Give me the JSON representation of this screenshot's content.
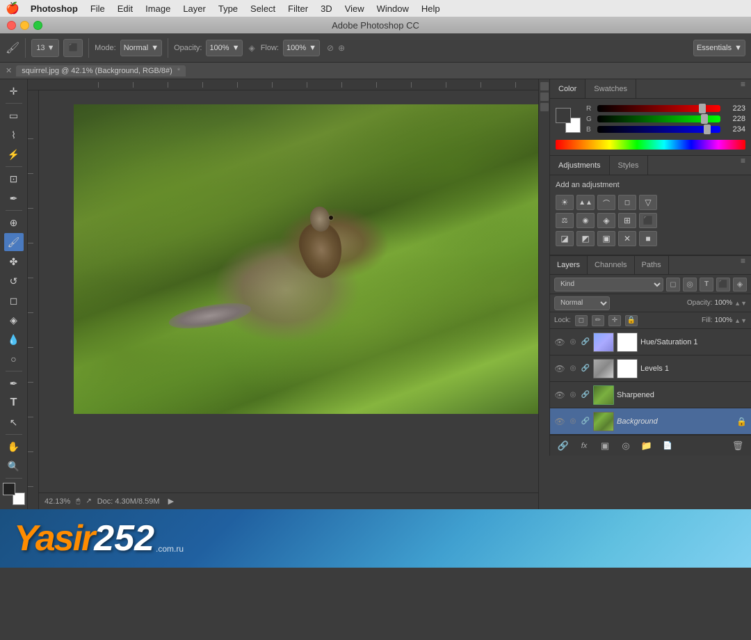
{
  "app": {
    "name": "Photoshop",
    "title": "Adobe Photoshop CC",
    "workspace": "Essentials"
  },
  "menubar": {
    "apple": "🍎",
    "items": [
      "Photoshop",
      "File",
      "Edit",
      "Image",
      "Layer",
      "Type",
      "Select",
      "Filter",
      "3D",
      "View",
      "Window",
      "Help"
    ]
  },
  "toolbar": {
    "brush_size": "13",
    "mode_label": "Mode:",
    "mode_value": "Normal",
    "opacity_label": "Opacity:",
    "opacity_value": "100%",
    "flow_label": "Flow:",
    "flow_value": "100%",
    "workspace": "Essentials"
  },
  "document": {
    "tab_title": "squirrel.jpg @ 42.1% (Background, RGB/8#)",
    "zoom": "42.13%",
    "doc_size": "Doc: 4.30M/8.59M"
  },
  "color_panel": {
    "tab_color": "Color",
    "tab_swatches": "Swatches",
    "r_value": "223",
    "g_value": "228",
    "b_value": "234"
  },
  "adjustments_panel": {
    "tab_adjustments": "Adjustments",
    "tab_styles": "Styles",
    "title": "Add an adjustment",
    "icons": [
      "☀",
      "▲",
      "◼",
      "◻",
      "▽",
      "⚖",
      "◉",
      "◈",
      "⊞",
      "⬛",
      "◪",
      "◩",
      "▣",
      "✕",
      "■"
    ]
  },
  "layers_panel": {
    "tab_layers": "Layers",
    "tab_channels": "Channels",
    "tab_paths": "Paths",
    "kind_label": "Kind",
    "blend_mode": "Normal",
    "opacity_label": "Opacity:",
    "opacity_value": "100%",
    "fill_label": "Fill:",
    "fill_value": "100%",
    "lock_label": "Lock:",
    "layers": [
      {
        "name": "Hue/Saturation 1",
        "type": "adjustment",
        "visible": true,
        "selected": false,
        "has_mask": true,
        "locked": false
      },
      {
        "name": "Levels 1",
        "type": "adjustment",
        "visible": true,
        "selected": false,
        "has_mask": true,
        "locked": false
      },
      {
        "name": "Sharpened",
        "type": "smart",
        "visible": true,
        "selected": false,
        "has_mask": false,
        "locked": false
      },
      {
        "name": "Background",
        "type": "background",
        "visible": true,
        "selected": true,
        "has_mask": false,
        "locked": true,
        "italic": true
      }
    ],
    "footer_btns": [
      "🔗",
      "fx",
      "▣",
      "◎",
      "📁",
      "🗑"
    ]
  }
}
